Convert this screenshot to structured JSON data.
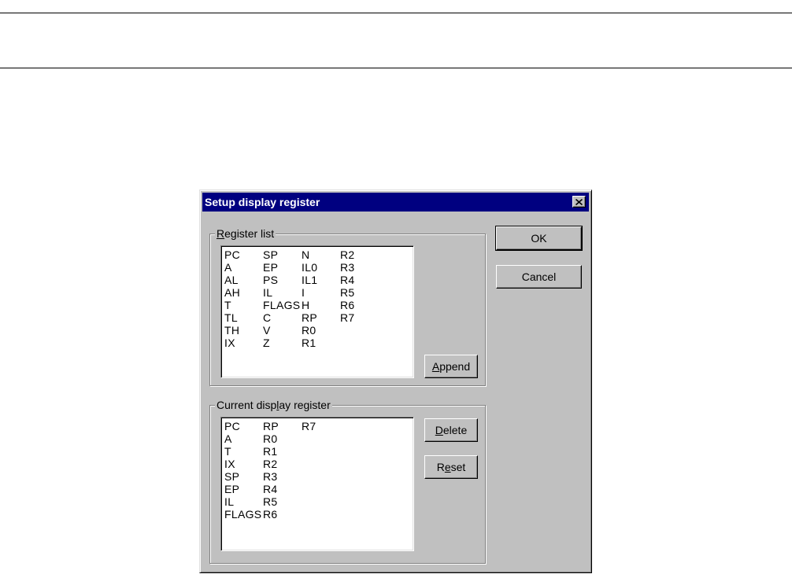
{
  "dialog": {
    "title": "Setup display register",
    "register_list_label": "Register list",
    "current_label": "Current display register",
    "register_list": [
      "PC",
      "A",
      "AL",
      "AH",
      "T",
      "TL",
      "TH",
      "IX",
      "SP",
      "EP",
      "PS",
      "IL",
      "FLAGS",
      "C",
      "V",
      "Z",
      "N",
      "IL0",
      "IL1",
      "I",
      "H",
      "RP",
      "R0",
      "R1",
      "R2",
      "R3",
      "R4",
      "R5",
      "R6",
      "R7"
    ],
    "current_list": [
      "PC",
      "A",
      "T",
      "IX",
      "SP",
      "EP",
      "IL",
      "FLAGS",
      "RP",
      "R0",
      "R1",
      "R2",
      "R3",
      "R4",
      "R5",
      "R6",
      "R7"
    ],
    "buttons": {
      "ok": "OK",
      "cancel": "Cancel",
      "append": "Append",
      "delete": "Delete",
      "reset": "Reset"
    }
  },
  "icons": {
    "close": "close-icon"
  }
}
